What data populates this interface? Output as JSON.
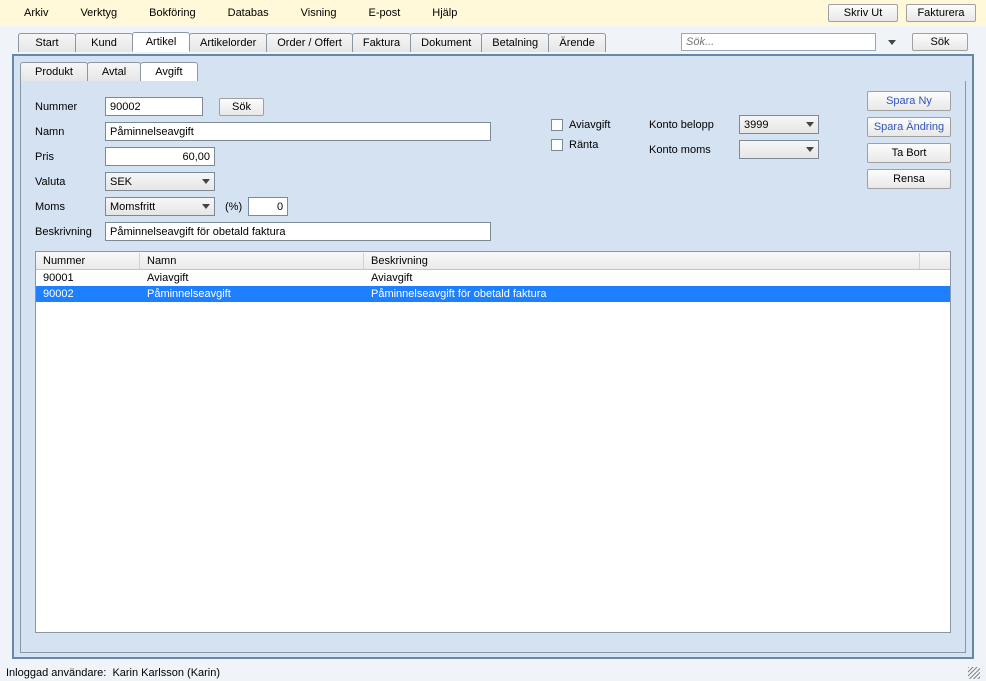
{
  "menu": {
    "items": [
      "Arkiv",
      "Verktyg",
      "Bokföring",
      "Databas",
      "Visning",
      "E-post",
      "Hjälp"
    ]
  },
  "top": {
    "print": "Skriv Ut",
    "invoice": "Fakturera"
  },
  "tabs": [
    "Start",
    "Kund",
    "Artikel",
    "Artikelorder",
    "Order / Offert",
    "Faktura",
    "Dokument",
    "Betalning",
    "Ärende"
  ],
  "search": {
    "placeholder": "Sök...",
    "button": "Sök"
  },
  "subTabs": [
    "Produkt",
    "Avtal",
    "Avgift"
  ],
  "form": {
    "nummer_label": "Nummer",
    "nummer": "90002",
    "sok": "Sök",
    "namn_label": "Namn",
    "namn": "Påminnelseavgift",
    "pris_label": "Pris",
    "pris": "60,00",
    "valuta_label": "Valuta",
    "valuta": "SEK",
    "moms_label": "Moms",
    "moms": "Momsfritt",
    "pct_label": "(%)",
    "pct": "0",
    "beskrivning_label": "Beskrivning",
    "beskrivning": "Påminnelseavgift för obetald faktura"
  },
  "checks": {
    "avi": "Aviavgift",
    "ranta": "Ränta"
  },
  "right": {
    "belopp_label": "Konto belopp",
    "belopp": "3999",
    "moms_label": "Konto moms",
    "moms": ""
  },
  "actions": {
    "spara_ny": "Spara Ny",
    "spara_andring": "Spara Ändring",
    "ta_bort": "Ta Bort",
    "rensa": "Rensa"
  },
  "table": {
    "headers": [
      "Nummer",
      "Namn",
      "Beskrivning"
    ],
    "rows": [
      {
        "nummer": "90001",
        "namn": "Aviavgift",
        "beskrivning": "Aviavgift",
        "selected": false
      },
      {
        "nummer": "90002",
        "namn": "Påminnelseavgift",
        "beskrivning": "Påminnelseavgift för obetald faktura",
        "selected": true
      }
    ]
  },
  "status": {
    "label": "Inloggad användare:",
    "user": "Karin Karlsson (Karin)"
  }
}
